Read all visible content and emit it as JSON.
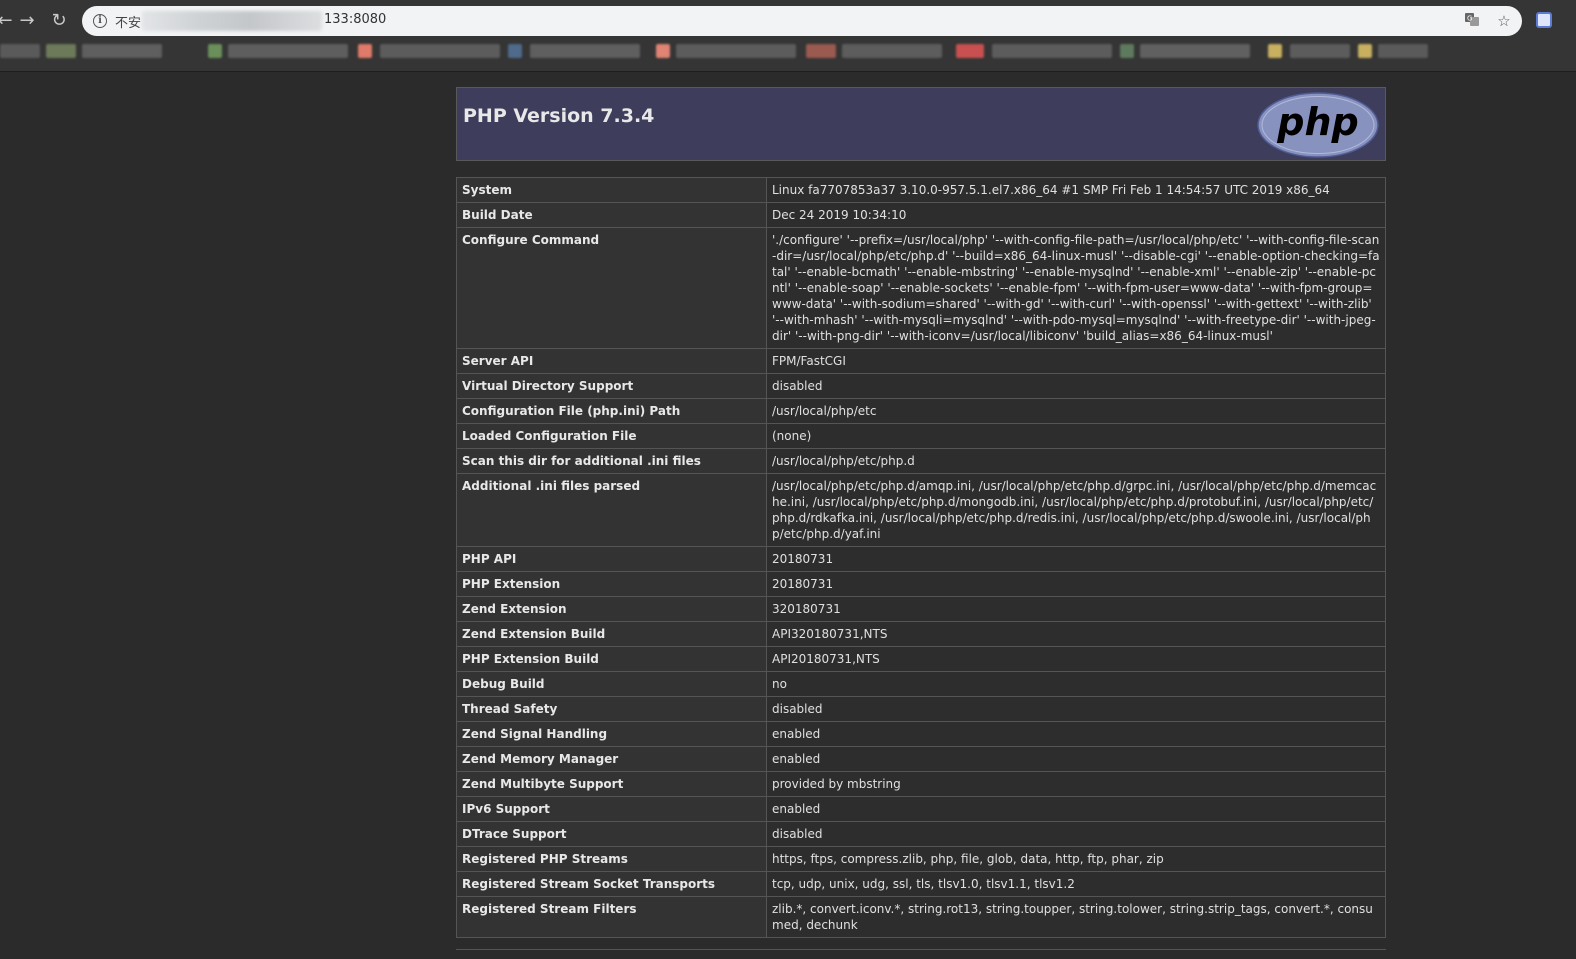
{
  "browser": {
    "address_bar": {
      "security_label": "不安",
      "url_suffix": "133:8080"
    },
    "icons": {
      "back": "back-arrow-icon",
      "forward": "forward-arrow-icon",
      "reload": "reload-icon",
      "info": "info-icon",
      "translate": "translate-icon",
      "bookmark": "star-icon",
      "extension": "extension-icon"
    }
  },
  "colors": {
    "page_background": "#2b2b2b",
    "header_background": "#3e3e5c",
    "key_cell": "#333333",
    "value_cell": "#2d2d2d",
    "php_logo": "#8892bf"
  },
  "phpinfo": {
    "title": "PHP Version 7.3.4",
    "logo_text": "php",
    "rows": [
      {
        "key": "System",
        "value": "Linux fa7707853a37 3.10.0-957.5.1.el7.x86_64 #1 SMP Fri Feb 1 14:54:57 UTC 2019 x86_64"
      },
      {
        "key": "Build Date",
        "value": "Dec 24 2019 10:34:10"
      },
      {
        "key": "Configure Command",
        "value": "'./configure' '--prefix=/usr/local/php' '--with-config-file-path=/usr/local/php/etc' '--with-config-file-scan-dir=/usr/local/php/etc/php.d' '--build=x86_64-linux-musl' '--disable-cgi' '--enable-option-checking=fatal' '--enable-bcmath' '--enable-mbstring' '--enable-mysqlnd' '--enable-xml' '--enable-zip' '--enable-pcntl' '--enable-soap' '--enable-sockets' '--enable-fpm' '--with-fpm-user=www-data' '--with-fpm-group=www-data' '--with-sodium=shared' '--with-gd' '--with-curl' '--with-openssl' '--with-gettext' '--with-zlib' '--with-mhash' '--with-mysqli=mysqlnd' '--with-pdo-mysql=mysqlnd' '--with-freetype-dir' '--with-jpeg-dir' '--with-png-dir' '--with-iconv=/usr/local/libiconv' 'build_alias=x86_64-linux-musl'"
      },
      {
        "key": "Server API",
        "value": "FPM/FastCGI"
      },
      {
        "key": "Virtual Directory Support",
        "value": "disabled"
      },
      {
        "key": "Configuration File (php.ini) Path",
        "value": "/usr/local/php/etc"
      },
      {
        "key": "Loaded Configuration File",
        "value": "(none)"
      },
      {
        "key": "Scan this dir for additional .ini files",
        "value": "/usr/local/php/etc/php.d"
      },
      {
        "key": "Additional .ini files parsed",
        "value": "/usr/local/php/etc/php.d/amqp.ini, /usr/local/php/etc/php.d/grpc.ini, /usr/local/php/etc/php.d/memcache.ini, /usr/local/php/etc/php.d/mongodb.ini, /usr/local/php/etc/php.d/protobuf.ini, /usr/local/php/etc/php.d/rdkafka.ini, /usr/local/php/etc/php.d/redis.ini, /usr/local/php/etc/php.d/swoole.ini, /usr/local/php/etc/php.d/yaf.ini"
      },
      {
        "key": "PHP API",
        "value": "20180731"
      },
      {
        "key": "PHP Extension",
        "value": "20180731"
      },
      {
        "key": "Zend Extension",
        "value": "320180731"
      },
      {
        "key": "Zend Extension Build",
        "value": "API320180731,NTS"
      },
      {
        "key": "PHP Extension Build",
        "value": "API20180731,NTS"
      },
      {
        "key": "Debug Build",
        "value": "no"
      },
      {
        "key": "Thread Safety",
        "value": "disabled"
      },
      {
        "key": "Zend Signal Handling",
        "value": "enabled"
      },
      {
        "key": "Zend Memory Manager",
        "value": "enabled"
      },
      {
        "key": "Zend Multibyte Support",
        "value": "provided by mbstring"
      },
      {
        "key": "IPv6 Support",
        "value": "enabled"
      },
      {
        "key": "DTrace Support",
        "value": "disabled"
      },
      {
        "key": "Registered PHP Streams",
        "value": "https, ftps, compress.zlib, php, file, glob, data, http, ftp, phar, zip"
      },
      {
        "key": "Registered Stream Socket Transports",
        "value": "tcp, udp, unix, udg, ssl, tls, tlsv1.0, tlsv1.1, tlsv1.2"
      },
      {
        "key": "Registered Stream Filters",
        "value": "zlib.*, convert.iconv.*, string.rot13, string.toupper, string.tolower, string.strip_tags, convert.*, consumed, dechunk"
      }
    ]
  }
}
